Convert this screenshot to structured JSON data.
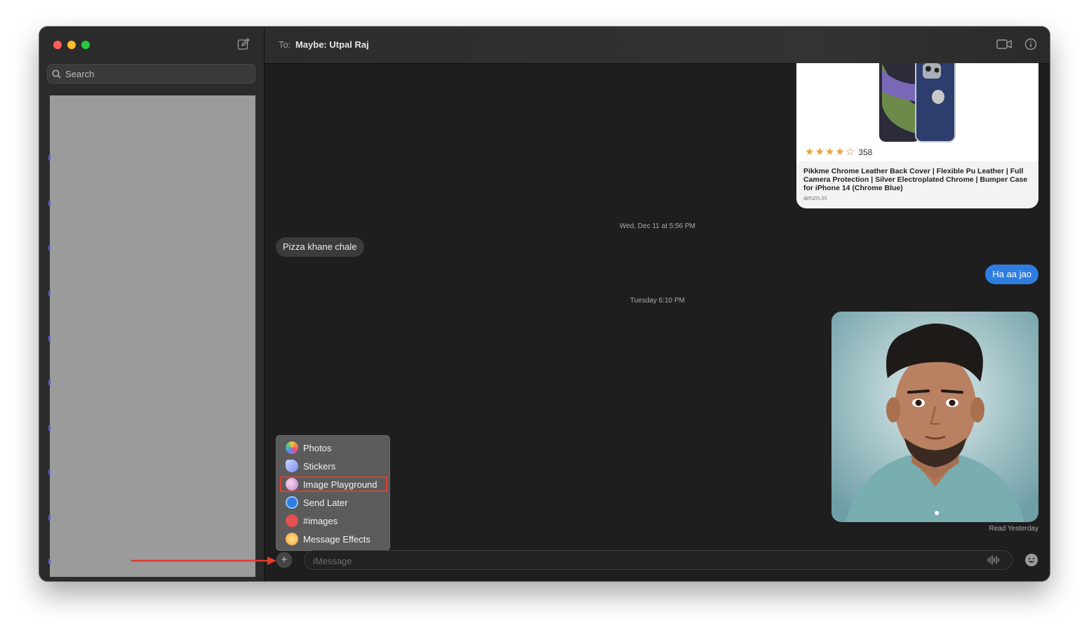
{
  "sidebar": {
    "search_placeholder": "Search"
  },
  "header": {
    "to_label": "To:",
    "recipient": "Maybe: Utpal Raj"
  },
  "link_preview": {
    "rating_count": "358",
    "stars": 4,
    "title": "Pikkme Chrome Leather Back Cover | Flexible Pu Leather | Full Camera Protection | Silver Electroplated Chrome | Bumper Case for iPhone 14 (Chrome Blue)",
    "domain": "amzn.in"
  },
  "messages": {
    "timestamp_1": "Wed, Dec 11 at 5:56 PM",
    "incoming_1": "Pizza khane chale",
    "outgoing_1": "Ha aa jao",
    "timestamp_2": "Tuesday 6:10 PM",
    "read_status": "Read Yesterday"
  },
  "app_menu": {
    "items": [
      {
        "label": "Photos",
        "icon": "photos-icon"
      },
      {
        "label": "Stickers",
        "icon": "stickers-icon"
      },
      {
        "label": "Image Playground",
        "icon": "image-playground-icon",
        "highlighted": true
      },
      {
        "label": "Send Later",
        "icon": "send-later-icon"
      },
      {
        "label": "#images",
        "icon": "images-search-icon"
      },
      {
        "label": "Message Effects",
        "icon": "message-effects-icon"
      }
    ]
  },
  "composer": {
    "placeholder": "iMessage"
  },
  "colors": {
    "highlight": "#e23b2e",
    "bubble_out": "#2f7de1",
    "bubble_in": "#3b3b3d"
  }
}
